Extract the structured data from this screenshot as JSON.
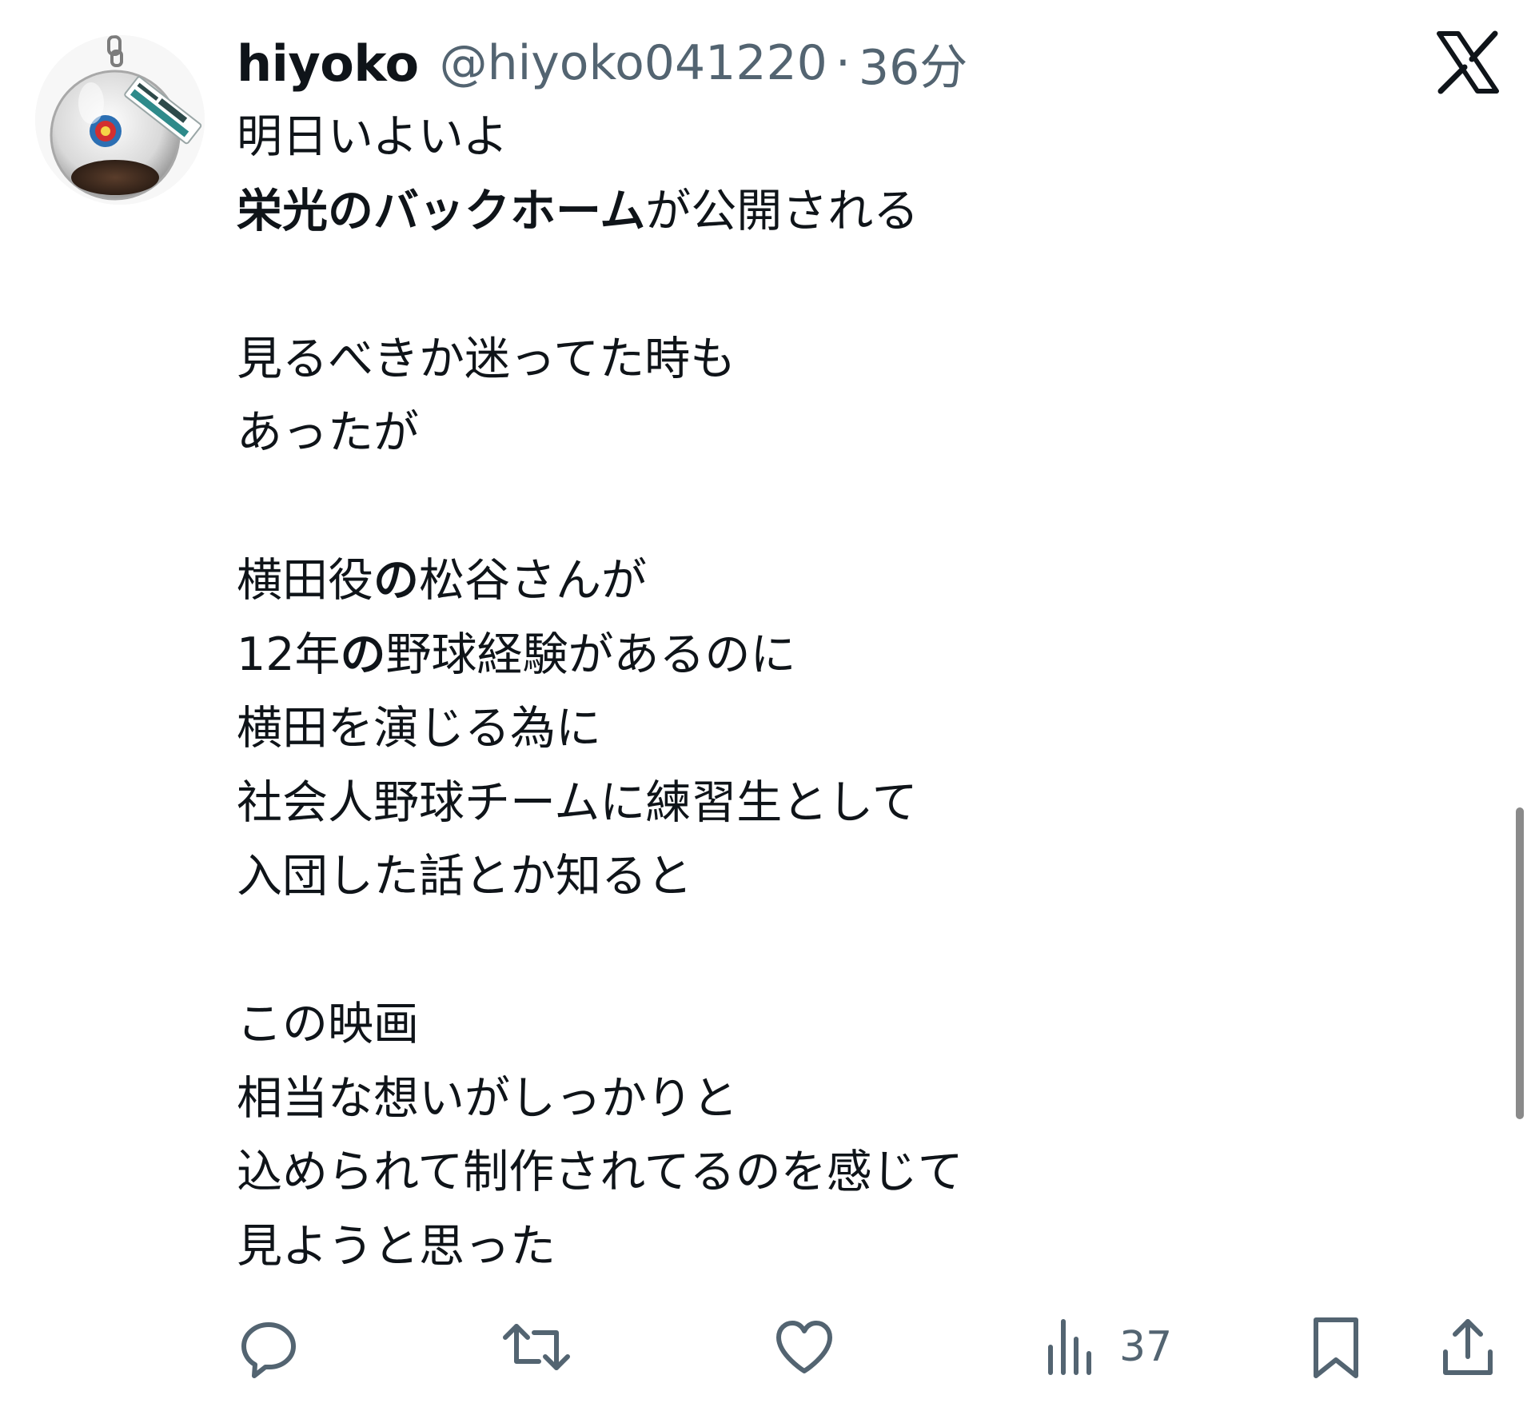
{
  "author": {
    "display_name": "hiyoko",
    "handle": "@hiyoko041220",
    "separator": "·",
    "time_ago": "36分"
  },
  "avatar": {
    "description_icon": "keychain-ball-icon",
    "tag_text_small": "HANSHIN Tigers",
    "tag_text_main": "阪神甲子園球場"
  },
  "platform_logo": "x-logo-icon",
  "body": {
    "line1": "明日いよいよ",
    "line2_bold": "栄光のバックホーム",
    "line2_rest": "が公開される",
    "line3": "見るべきか迷ってた時も",
    "line4": "あったが",
    "line5_a": "横田役",
    "line5_b": "の",
    "line5_c": "松谷さんが",
    "line6_a": "12年",
    "line6_b": "の",
    "line6_c": "野球経験があるのに",
    "line7": "横田を演じる為に",
    "line8": "社会人野球チームに練習生として",
    "line9": "入団した話とか知ると",
    "line10": "この映画",
    "line11": "相当な想いがしっかりと",
    "line12": "込められて制作されてるのを感じて",
    "line13": "見ようと思った"
  },
  "actions": {
    "reply_icon": "reply-icon",
    "retweet_icon": "retweet-icon",
    "like_icon": "heart-icon",
    "views_icon": "views-chart-icon",
    "views_count": "37",
    "bookmark_icon": "bookmark-icon",
    "share_icon": "share-icon"
  },
  "colors": {
    "text_primary": "#0f1419",
    "text_secondary": "#536471",
    "background": "#ffffff"
  }
}
